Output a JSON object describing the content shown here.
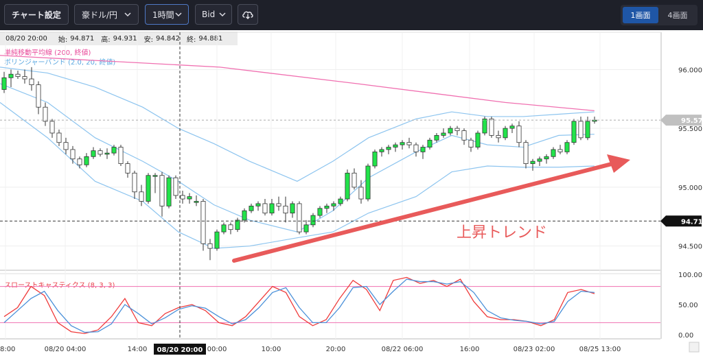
{
  "toolbar": {
    "chart_settings": "チャート設定",
    "pair": "豪ドル/円",
    "timeframe": "1時間",
    "price_type": "Bid",
    "layout_1": "1画面",
    "layout_4": "4画面"
  },
  "info_bar": {
    "time": "08/20 20:00",
    "open_label": "始:",
    "open": "94.871",
    "high_label": "高:",
    "high": "94.931",
    "low_label": "安:",
    "low": "94.842",
    "close_label": "終:",
    "close": "94.881"
  },
  "legend": {
    "sma": "単純移動平均線 (200, 終値)",
    "bollinger": "ボリンジャーバンド (2.0, 20, 終値)",
    "stochastic": "スローストキャスティクス (8, 3, 3)"
  },
  "annotation": "上昇トレンド",
  "colors": {
    "up": "#22e34a",
    "down": "#ffffff",
    "sma": "#f06fb0",
    "bollinger": "#8cc4ef",
    "stoch_k": "#ef3b3b",
    "stoch_d": "#4a90d9",
    "arrow": "#e85a5a",
    "toolbar_bg": "#1e2029"
  },
  "chart_data": [
    {
      "type": "candlestick",
      "title": "豪ドル/円 1時間 Bid",
      "ylim": [
        94.3,
        96.2
      ],
      "y_ticks": [
        "96.000",
        "95.500",
        "95.000",
        "94.500"
      ],
      "x_ticks": [
        "18:00",
        "08/20 04:00",
        "14:00",
        "08/20 20:00",
        "00:00",
        "10:00",
        "20:00",
        "08/22 06:00",
        "16:00",
        "08/23 02:00",
        "08/25 13:00"
      ],
      "current_price": "95.570",
      "crosshair_price": "94.712",
      "crosshair_time": "08/20 20:00",
      "candles": [
        {
          "o": 95.83,
          "h": 95.98,
          "l": 95.8,
          "c": 95.93
        },
        {
          "o": 95.93,
          "h": 96.0,
          "l": 95.85,
          "c": 95.96
        },
        {
          "o": 95.96,
          "h": 95.99,
          "l": 95.92,
          "c": 95.94
        },
        {
          "o": 95.94,
          "h": 96.0,
          "l": 95.88,
          "c": 95.92
        },
        {
          "o": 95.92,
          "h": 96.02,
          "l": 95.82,
          "c": 95.87
        },
        {
          "o": 95.87,
          "h": 95.9,
          "l": 95.62,
          "c": 95.68
        },
        {
          "o": 95.68,
          "h": 95.72,
          "l": 95.52,
          "c": 95.56
        },
        {
          "o": 95.56,
          "h": 95.58,
          "l": 95.42,
          "c": 95.46
        },
        {
          "o": 95.46,
          "h": 95.49,
          "l": 95.35,
          "c": 95.38
        },
        {
          "o": 95.38,
          "h": 95.42,
          "l": 95.28,
          "c": 95.32
        },
        {
          "o": 95.32,
          "h": 95.35,
          "l": 95.2,
          "c": 95.24
        },
        {
          "o": 95.24,
          "h": 95.26,
          "l": 95.16,
          "c": 95.19
        },
        {
          "o": 95.19,
          "h": 95.29,
          "l": 95.17,
          "c": 95.26
        },
        {
          "o": 95.26,
          "h": 95.34,
          "l": 95.24,
          "c": 95.31
        },
        {
          "o": 95.31,
          "h": 95.33,
          "l": 95.26,
          "c": 95.28
        },
        {
          "o": 95.28,
          "h": 95.33,
          "l": 95.24,
          "c": 95.29
        },
        {
          "o": 95.29,
          "h": 95.36,
          "l": 95.27,
          "c": 95.34
        },
        {
          "o": 95.34,
          "h": 95.36,
          "l": 95.18,
          "c": 95.2
        },
        {
          "o": 95.2,
          "h": 95.22,
          "l": 95.08,
          "c": 95.12
        },
        {
          "o": 95.12,
          "h": 95.14,
          "l": 94.9,
          "c": 94.96
        },
        {
          "o": 94.96,
          "h": 95.02,
          "l": 94.84,
          "c": 94.88
        },
        {
          "o": 94.88,
          "h": 95.12,
          "l": 94.86,
          "c": 95.1
        },
        {
          "o": 95.1,
          "h": 95.12,
          "l": 94.95,
          "c": 95.1
        },
        {
          "o": 95.1,
          "h": 95.13,
          "l": 94.75,
          "c": 94.84
        },
        {
          "o": 94.84,
          "h": 95.1,
          "l": 94.82,
          "c": 95.08
        },
        {
          "o": 95.08,
          "h": 95.1,
          "l": 94.9,
          "c": 94.93
        },
        {
          "o": 94.93,
          "h": 94.97,
          "l": 94.86,
          "c": 94.9
        },
        {
          "o": 94.9,
          "h": 94.95,
          "l": 94.86,
          "c": 94.92
        },
        {
          "o": 94.87,
          "h": 94.93,
          "l": 94.84,
          "c": 94.88
        },
        {
          "o": 94.88,
          "h": 94.9,
          "l": 94.46,
          "c": 94.52
        },
        {
          "o": 94.52,
          "h": 94.56,
          "l": 94.38,
          "c": 94.48
        },
        {
          "o": 94.48,
          "h": 94.64,
          "l": 94.46,
          "c": 94.62
        },
        {
          "o": 94.62,
          "h": 94.7,
          "l": 94.6,
          "c": 94.68
        },
        {
          "o": 94.68,
          "h": 94.7,
          "l": 94.6,
          "c": 94.64
        },
        {
          "o": 94.64,
          "h": 94.74,
          "l": 94.62,
          "c": 94.72
        },
        {
          "o": 94.72,
          "h": 94.82,
          "l": 94.7,
          "c": 94.8
        },
        {
          "o": 94.8,
          "h": 94.86,
          "l": 94.78,
          "c": 94.84
        },
        {
          "o": 94.84,
          "h": 94.88,
          "l": 94.8,
          "c": 94.86
        },
        {
          "o": 94.86,
          "h": 94.9,
          "l": 94.76,
          "c": 94.78
        },
        {
          "o": 94.78,
          "h": 94.9,
          "l": 94.76,
          "c": 94.86
        },
        {
          "o": 94.86,
          "h": 94.92,
          "l": 94.8,
          "c": 94.84
        },
        {
          "o": 94.84,
          "h": 94.92,
          "l": 94.7,
          "c": 94.78
        },
        {
          "o": 94.78,
          "h": 94.88,
          "l": 94.74,
          "c": 94.86
        },
        {
          "o": 94.86,
          "h": 94.88,
          "l": 94.6,
          "c": 94.62
        },
        {
          "o": 94.62,
          "h": 94.72,
          "l": 94.6,
          "c": 94.68
        },
        {
          "o": 94.68,
          "h": 94.78,
          "l": 94.66,
          "c": 94.76
        },
        {
          "o": 94.76,
          "h": 94.84,
          "l": 94.74,
          "c": 94.82
        },
        {
          "o": 94.82,
          "h": 94.86,
          "l": 94.78,
          "c": 94.84
        },
        {
          "o": 94.84,
          "h": 94.88,
          "l": 94.8,
          "c": 94.86
        },
        {
          "o": 94.86,
          "h": 94.92,
          "l": 94.84,
          "c": 94.9
        },
        {
          "o": 94.9,
          "h": 95.15,
          "l": 94.88,
          "c": 95.12
        },
        {
          "o": 95.12,
          "h": 95.16,
          "l": 94.98,
          "c": 95.0
        },
        {
          "o": 95.0,
          "h": 95.06,
          "l": 94.86,
          "c": 94.9
        },
        {
          "o": 94.9,
          "h": 95.2,
          "l": 94.88,
          "c": 95.18
        },
        {
          "o": 95.18,
          "h": 95.32,
          "l": 95.16,
          "c": 95.3
        },
        {
          "o": 95.3,
          "h": 95.34,
          "l": 95.26,
          "c": 95.32
        },
        {
          "o": 95.32,
          "h": 95.36,
          "l": 95.28,
          "c": 95.34
        },
        {
          "o": 95.34,
          "h": 95.38,
          "l": 95.3,
          "c": 95.36
        },
        {
          "o": 95.36,
          "h": 95.4,
          "l": 95.32,
          "c": 95.38
        },
        {
          "o": 95.38,
          "h": 95.42,
          "l": 95.33,
          "c": 95.36
        },
        {
          "o": 95.36,
          "h": 95.38,
          "l": 95.26,
          "c": 95.3
        },
        {
          "o": 95.3,
          "h": 95.36,
          "l": 95.24,
          "c": 95.34
        },
        {
          "o": 95.34,
          "h": 95.42,
          "l": 95.32,
          "c": 95.4
        },
        {
          "o": 95.4,
          "h": 95.46,
          "l": 95.38,
          "c": 95.44
        },
        {
          "o": 95.44,
          "h": 95.5,
          "l": 95.42,
          "c": 95.46
        },
        {
          "o": 95.46,
          "h": 95.52,
          "l": 95.44,
          "c": 95.5
        },
        {
          "o": 95.5,
          "h": 95.52,
          "l": 95.44,
          "c": 95.48
        },
        {
          "o": 95.48,
          "h": 95.5,
          "l": 95.36,
          "c": 95.4
        },
        {
          "o": 95.4,
          "h": 95.42,
          "l": 95.3,
          "c": 95.34
        },
        {
          "o": 95.34,
          "h": 95.48,
          "l": 95.32,
          "c": 95.46
        },
        {
          "o": 95.46,
          "h": 95.6,
          "l": 95.44,
          "c": 95.58
        },
        {
          "o": 95.58,
          "h": 95.6,
          "l": 95.42,
          "c": 95.44
        },
        {
          "o": 95.44,
          "h": 95.48,
          "l": 95.38,
          "c": 95.42
        },
        {
          "o": 95.42,
          "h": 95.52,
          "l": 95.4,
          "c": 95.5
        },
        {
          "o": 95.5,
          "h": 95.54,
          "l": 95.46,
          "c": 95.52
        },
        {
          "o": 95.52,
          "h": 95.56,
          "l": 95.34,
          "c": 95.38
        },
        {
          "o": 95.38,
          "h": 95.4,
          "l": 95.16,
          "c": 95.2
        },
        {
          "o": 95.2,
          "h": 95.24,
          "l": 95.14,
          "c": 95.22
        },
        {
          "o": 95.22,
          "h": 95.26,
          "l": 95.18,
          "c": 95.24
        },
        {
          "o": 95.24,
          "h": 95.28,
          "l": 95.2,
          "c": 95.26
        },
        {
          "o": 95.26,
          "h": 95.34,
          "l": 95.24,
          "c": 95.32
        },
        {
          "o": 95.32,
          "h": 95.36,
          "l": 95.28,
          "c": 95.3
        },
        {
          "o": 95.3,
          "h": 95.4,
          "l": 95.28,
          "c": 95.38
        },
        {
          "o": 95.38,
          "h": 95.58,
          "l": 95.36,
          "c": 95.56
        },
        {
          "o": 95.56,
          "h": 95.6,
          "l": 95.4,
          "c": 95.42
        },
        {
          "o": 95.42,
          "h": 95.6,
          "l": 95.4,
          "c": 95.56
        },
        {
          "o": 95.56,
          "h": 95.6,
          "l": 95.54,
          "c": 95.57
        }
      ],
      "sma_200": [
        [
          0,
          96.12
        ],
        [
          0.37,
          96.02
        ],
        [
          0.6,
          95.88
        ],
        [
          0.85,
          95.72
        ],
        [
          1,
          95.65
        ]
      ],
      "bollinger_upper": [
        [
          0,
          96.02
        ],
        [
          0.08,
          95.97
        ],
        [
          0.16,
          95.85
        ],
        [
          0.24,
          95.68
        ],
        [
          0.3,
          95.5
        ],
        [
          0.36,
          95.37
        ],
        [
          0.42,
          95.22
        ],
        [
          0.5,
          95.05
        ],
        [
          0.56,
          95.22
        ],
        [
          0.62,
          95.42
        ],
        [
          0.7,
          95.58
        ],
        [
          0.76,
          95.64
        ],
        [
          0.82,
          95.6
        ],
        [
          0.88,
          95.6
        ],
        [
          0.94,
          95.62
        ],
        [
          1,
          95.64
        ]
      ],
      "bollinger_middle": [
        [
          0,
          95.88
        ],
        [
          0.08,
          95.72
        ],
        [
          0.16,
          95.42
        ],
        [
          0.24,
          95.22
        ],
        [
          0.3,
          95.05
        ],
        [
          0.36,
          94.85
        ],
        [
          0.42,
          94.72
        ],
        [
          0.5,
          94.62
        ],
        [
          0.56,
          94.8
        ],
        [
          0.62,
          95.08
        ],
        [
          0.7,
          95.3
        ],
        [
          0.76,
          95.44
        ],
        [
          0.82,
          95.36
        ],
        [
          0.88,
          95.34
        ],
        [
          0.94,
          95.44
        ],
        [
          1,
          95.45
        ]
      ],
      "bollinger_lower": [
        [
          0,
          95.72
        ],
        [
          0.08,
          95.42
        ],
        [
          0.16,
          95.05
        ],
        [
          0.24,
          94.88
        ],
        [
          0.3,
          94.62
        ],
        [
          0.36,
          94.48
        ],
        [
          0.42,
          94.5
        ],
        [
          0.5,
          94.57
        ],
        [
          0.56,
          94.62
        ],
        [
          0.62,
          94.78
        ],
        [
          0.7,
          94.92
        ],
        [
          0.76,
          95.13
        ],
        [
          0.82,
          95.18
        ],
        [
          0.88,
          95.17
        ],
        [
          0.94,
          95.17
        ],
        [
          1,
          95.18
        ]
      ]
    },
    {
      "type": "line",
      "title": "スローストキャスティクス (8, 3, 3)",
      "ylim": [
        0,
        100
      ],
      "y_ticks": [
        "100.00",
        "50.00",
        "0.00"
      ],
      "levels": [
        80,
        20
      ],
      "series": [
        {
          "name": "%K",
          "values": [
            30,
            45,
            80,
            65,
            20,
            5,
            2,
            8,
            30,
            60,
            20,
            15,
            35,
            45,
            50,
            40,
            20,
            15,
            30,
            55,
            80,
            70,
            30,
            15,
            25,
            60,
            90,
            75,
            40,
            90,
            95,
            85,
            90,
            80,
            92,
            55,
            30,
            25,
            25,
            22,
            15,
            25,
            70,
            75,
            68
          ]
        },
        {
          "name": "%D",
          "values": [
            20,
            40,
            60,
            72,
            40,
            15,
            4,
            5,
            18,
            50,
            35,
            18,
            28,
            42,
            48,
            44,
            30,
            18,
            25,
            45,
            70,
            78,
            45,
            20,
            20,
            45,
            78,
            80,
            50,
            72,
            92,
            88,
            88,
            84,
            88,
            70,
            40,
            28,
            24,
            22,
            18,
            22,
            55,
            72,
            70
          ]
        }
      ]
    }
  ]
}
